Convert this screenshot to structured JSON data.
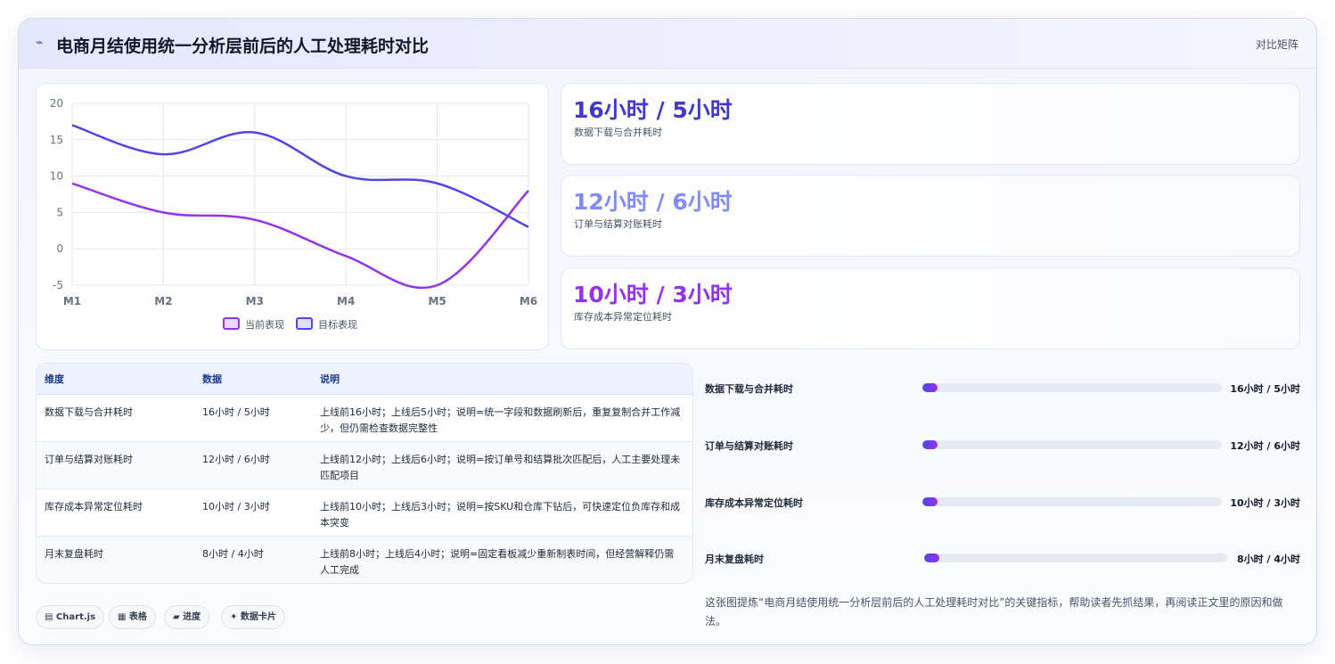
{
  "header": {
    "logo": "⌁",
    "title": "电商月结使用统一分析层前后的人工处理耗时对比",
    "link": "对比矩阵"
  },
  "colors": {
    "series1": "#9333ea",
    "series2": "#4f46e5",
    "card1": "#4338ca",
    "card2": "#818cf8",
    "card3": "#9333ea"
  },
  "chart_data": {
    "type": "line",
    "categories": [
      "M1",
      "M2",
      "M3",
      "M4",
      "M5",
      "M6"
    ],
    "ylim": [
      -5,
      20
    ],
    "yticks": [
      20,
      15,
      10,
      5,
      0,
      -5
    ],
    "grid": true,
    "legend_position": "bottom",
    "series": [
      {
        "name": "当前表现",
        "values": [
          9,
          5,
          4,
          -1,
          -5,
          8
        ]
      },
      {
        "name": "目标表现",
        "values": [
          17,
          13,
          16,
          10,
          9,
          3
        ]
      }
    ]
  },
  "cards": [
    {
      "value": "16小时 / 5小时",
      "label": "数据下载与合并耗时"
    },
    {
      "value": "12小时 / 6小时",
      "label": "订单与结算对账耗时"
    },
    {
      "value": "10小时 / 3小时",
      "label": "库存成本异常定位耗时"
    }
  ],
  "table": {
    "headers": [
      "维度",
      "数据",
      "说明"
    ],
    "rows": [
      [
        "数据下载与合并耗时",
        "16小时 / 5小时",
        "上线前16小时；上线后5小时；说明=统一字段和数据刷新后，重复复制合并工作减少，但仍需检查数据完整性"
      ],
      [
        "订单与结算对账耗时",
        "12小时 / 6小时",
        "上线前12小时；上线后6小时；说明=按订单号和结算批次匹配后，人工主要处理未匹配项目"
      ],
      [
        "库存成本异常定位耗时",
        "10小时 / 3小时",
        "上线前10小时；上线后3小时；说明=按SKU和仓库下钻后，可快速定位负库存和成本突变"
      ],
      [
        "月末复盘耗时",
        "8小时 / 4小时",
        "上线前8小时；上线后4小时；说明=固定看板减少重新制表时间，但经营解释仍需人工完成"
      ]
    ]
  },
  "chips": [
    "▤ Chart.js",
    "▦ 表格",
    "▰ 进度",
    "✦ 数据卡片"
  ],
  "progress": [
    {
      "label": "数据下载与合并耗时",
      "value": "16小时 / 5小时",
      "fraction": 0.05
    },
    {
      "label": "订单与结算对账耗时",
      "value": "12小时 / 6小时",
      "fraction": 0.05
    },
    {
      "label": "库存成本异常定位耗时",
      "value": "10小时 / 3小时",
      "fraction": 0.05
    },
    {
      "label": "月末复盘耗时",
      "value": "8小时 / 4小时",
      "fraction": 0.05
    }
  ],
  "note": "这张图提炼“电商月结使用统一分析层前后的人工处理耗时对比”的关键指标，帮助读者先抓结果，再阅读正文里的原因和做法。"
}
